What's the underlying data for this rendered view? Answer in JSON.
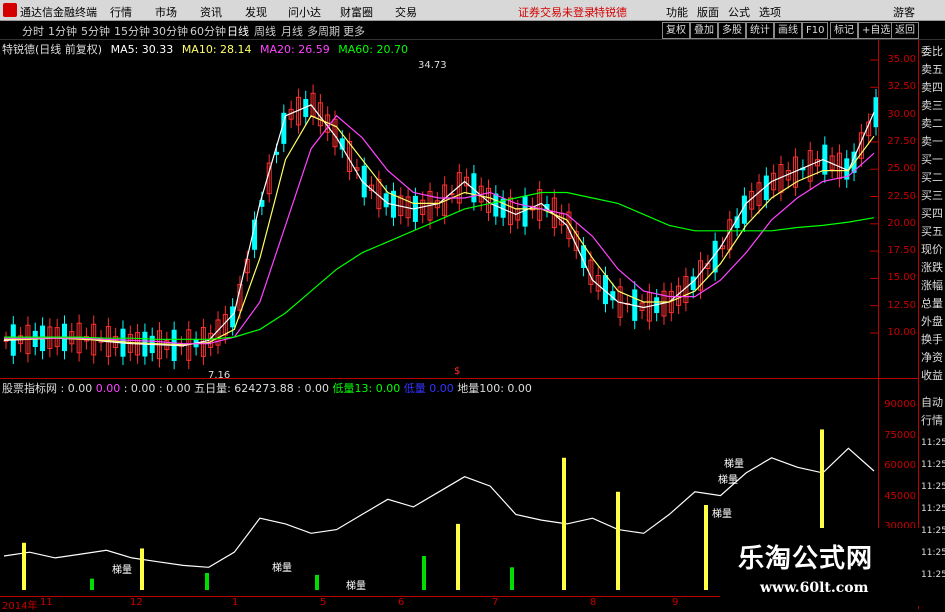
{
  "menubar": {
    "title": "通达信金融终端",
    "items": [
      "行情",
      "市场",
      "资讯",
      "发现",
      "问小达",
      "财富圈",
      "交易"
    ],
    "warning": "证券交易未登录",
    "brand": "特锐德",
    "right_items": [
      "功能",
      "版面",
      "公式",
      "选项"
    ],
    "user": "游客"
  },
  "toolbar": {
    "periods": [
      "分时",
      "1分钟",
      "5分钟",
      "15分钟",
      "30分钟",
      "60分钟",
      "日线",
      "周线",
      "月线",
      "多周期",
      "更多"
    ],
    "selected": "日线",
    "right_buttons": [
      "复权",
      "叠加",
      "多股",
      "统计",
      "画线",
      "F10",
      "标记",
      "+自选",
      "返回"
    ]
  },
  "info": {
    "stock": "特锐德(日线 前复权)",
    "ma5": "MA5: 30.33",
    "ma10": "MA10: 28.14",
    "ma20": "MA20: 26.59",
    "ma60": "MA60: 20.70"
  },
  "volinfo": {
    "indicator": "股票指标网",
    "v1": ": 0.00",
    "v2": "0.00",
    "v3": ": 0.00",
    "v4": ": 0.00",
    "wu": "五日量: 624273.88",
    "wu2": ": 0.00",
    "low": "低量13: 0.00",
    "low2": "低量",
    "low3": "0.00",
    "floor": "地量100: 0.00"
  },
  "side_labels": [
    "委比",
    "卖五",
    "卖四",
    "卖三",
    "卖二",
    "卖一",
    "买一",
    "买二",
    "买三",
    "买四",
    "买五",
    "现价",
    "涨跌",
    "涨幅",
    "总量",
    "外盘",
    "换手",
    "净资",
    "收益",
    "自动",
    "行情"
  ],
  "side_times": [
    "11:25",
    "11:25",
    "11:25",
    "11:25",
    "11:25",
    "11:25",
    "11:25"
  ],
  "price_axis": [
    "35.00",
    "32.50",
    "30.00",
    "27.50",
    "25.00",
    "22.50",
    "20.00",
    "17.50",
    "15.00",
    "12.50",
    "10.00"
  ],
  "vol_axis": [
    "90000",
    "75000",
    "60000",
    "45000",
    "30000"
  ],
  "x_axis": [
    "2014年",
    "11",
    "12",
    "1",
    "5",
    "6",
    "7",
    "8",
    "9"
  ],
  "annotations": {
    "high": "34.73",
    "low": "7.16",
    "tiliang": "梯量",
    "dollar": "$"
  },
  "watermark": {
    "title": "乐淘公式网",
    "url": "www.60lt.com"
  },
  "colors": {
    "up": "#ff3030",
    "down": "#00ffff",
    "ma5": "#ffffff",
    "ma10": "#ffff66",
    "ma20": "#ff44ff",
    "ma60": "#00ff00",
    "axis": "#c80000"
  },
  "chart_data": [
    {
      "type": "line",
      "title": "特锐德(日线 前复权)",
      "ylim": [
        7.16,
        34.73
      ],
      "series": [
        {
          "name": "MA5",
          "values": [
            9.5,
            9.6,
            9.8,
            9.7,
            9.4,
            9.2,
            9.1,
            9.0,
            9.5,
            12,
            22,
            30,
            31,
            28,
            24,
            22,
            21.5,
            22,
            24,
            22,
            21,
            22,
            20,
            15,
            13,
            12.5,
            13,
            15,
            18,
            22,
            24,
            25,
            26,
            25,
            30.33
          ]
        },
        {
          "name": "MA10",
          "values": [
            9.6,
            9.6,
            9.7,
            9.6,
            9.5,
            9.3,
            9.2,
            9.1,
            9.3,
            10.5,
            17,
            26,
            30,
            29,
            26,
            23,
            22,
            22,
            23,
            22.5,
            21.5,
            21.5,
            20.5,
            17,
            14,
            13,
            13,
            14,
            16.5,
            20,
            22.5,
            24,
            25,
            25,
            28.14
          ]
        },
        {
          "name": "MA20",
          "values": [
            9.7,
            9.7,
            9.7,
            9.7,
            9.6,
            9.5,
            9.4,
            9.2,
            9.2,
            9.8,
            13,
            20,
            27,
            30,
            28,
            25,
            23,
            22.5,
            22.5,
            23,
            22,
            21.5,
            21,
            19,
            16,
            14,
            13.5,
            13.5,
            15,
            17.5,
            20.5,
            22.5,
            24,
            24.5,
            26.59
          ]
        },
        {
          "name": "MA60",
          "values": [
            9.8,
            9.8,
            9.8,
            9.8,
            9.7,
            9.7,
            9.6,
            9.6,
            9.6,
            9.8,
            10.5,
            12,
            14,
            16,
            17.5,
            18.5,
            19.5,
            20.5,
            21.5,
            22,
            22.5,
            23,
            23,
            22.5,
            22,
            21,
            20,
            19.5,
            19.5,
            19.5,
            19.5,
            19.8,
            20,
            20.3,
            20.7
          ]
        }
      ]
    },
    {
      "type": "bar",
      "ylim": [
        0,
        90000
      ],
      "series": [
        {
          "name": "五日量",
          "values": [
            18000,
            20000,
            17000,
            19000,
            21000,
            17000,
            15000,
            13000,
            12000,
            20000,
            38000,
            35000,
            30000,
            32000,
            40000,
            48000,
            44000,
            52000,
            60000,
            55000,
            40000,
            37000,
            35000,
            38000,
            32000,
            30000,
            40000,
            52000,
            50000,
            62000,
            70000,
            65000,
            62000,
            75000,
            63000
          ]
        }
      ]
    }
  ]
}
